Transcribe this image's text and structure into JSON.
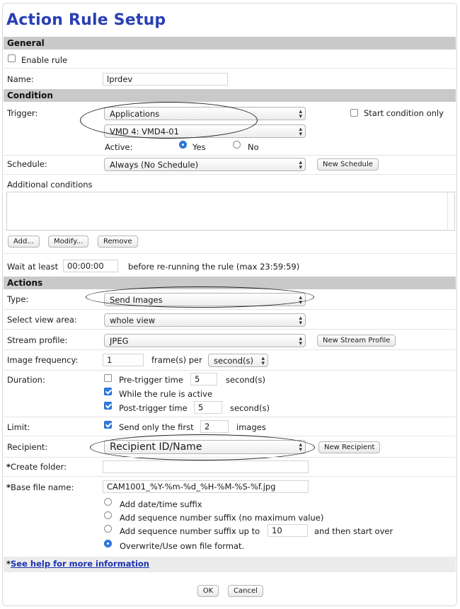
{
  "title": "Action Rule Setup",
  "sections": {
    "general": "General",
    "condition": "Condition",
    "actions": "Actions"
  },
  "general": {
    "enable_rule_label": "Enable rule",
    "enable_rule_checked": false,
    "name_label": "Name:",
    "name_value": "lprdev"
  },
  "condition": {
    "trigger_label": "Trigger:",
    "trigger_value": "Applications",
    "trigger_sub_value": "VMD 4: VMD4-01",
    "start_condition_only_label": "Start condition only",
    "start_condition_only_checked": false,
    "active_label": "Active:",
    "active_yes": "Yes",
    "active_no": "No",
    "active_selected": "Yes",
    "schedule_label": "Schedule:",
    "schedule_value": "Always (No Schedule)",
    "new_schedule_button": "New Schedule",
    "additional_conditions_label": "Additional conditions",
    "add_button": "Add...",
    "modify_button": "Modify...",
    "remove_button": "Remove",
    "wait_label": "Wait at least",
    "wait_value": "00:00:00",
    "wait_suffix": "before re-running the rule (max 23:59:59)"
  },
  "actions": {
    "type_label": "Type:",
    "type_value": "Send Images",
    "view_area_label": "Select view area:",
    "view_area_value": "whole view",
    "stream_profile_label": "Stream profile:",
    "stream_profile_value": "JPEG",
    "new_stream_profile_button": "New Stream Profile",
    "image_frequency_label": "Image frequency:",
    "image_frequency_value": "1",
    "frames_per_label": "frame(s) per",
    "frequency_unit_value": "second(s)",
    "duration_label": "Duration:",
    "pre_trigger_label": "Pre-trigger time",
    "pre_trigger_checked": false,
    "pre_trigger_value": "5",
    "pre_trigger_unit": "second(s)",
    "while_active_label": "While the rule is active",
    "while_active_checked": true,
    "post_trigger_label": "Post-trigger time",
    "post_trigger_checked": true,
    "post_trigger_value": "5",
    "post_trigger_unit": "second(s)",
    "limit_label": "Limit:",
    "send_only_first_label": "Send only the first",
    "send_only_first_checked": true,
    "send_only_first_value": "2",
    "images_label": "images",
    "recipient_label": "Recipient:",
    "recipient_value": "Recipient ID/Name",
    "new_recipient_button": "New Recipient",
    "create_folder_label": "Create folder:",
    "create_folder_value": "",
    "base_file_name_label": "Base file name:",
    "base_file_name_value": "CAM1001_%Y-%m-%d_%H-%M-%S-%f.jpg",
    "suffix_options": [
      "Add date/time suffix",
      "Add sequence number suffix (no maximum value)",
      "Add sequence number suffix up to",
      "Overwrite/Use own file format."
    ],
    "suffix_selected": 3,
    "suffix_upto_value": "10",
    "suffix_upto_tail": "and then start over",
    "asterisk": "*"
  },
  "footer": {
    "help_link": "See help for more information",
    "ok_button": "OK",
    "cancel_button": "Cancel"
  },
  "colors": {
    "title": "#2a3fb4",
    "section_bg": "#c9c9c9",
    "checked": "#2f7ae5",
    "link": "#1b33b0"
  }
}
